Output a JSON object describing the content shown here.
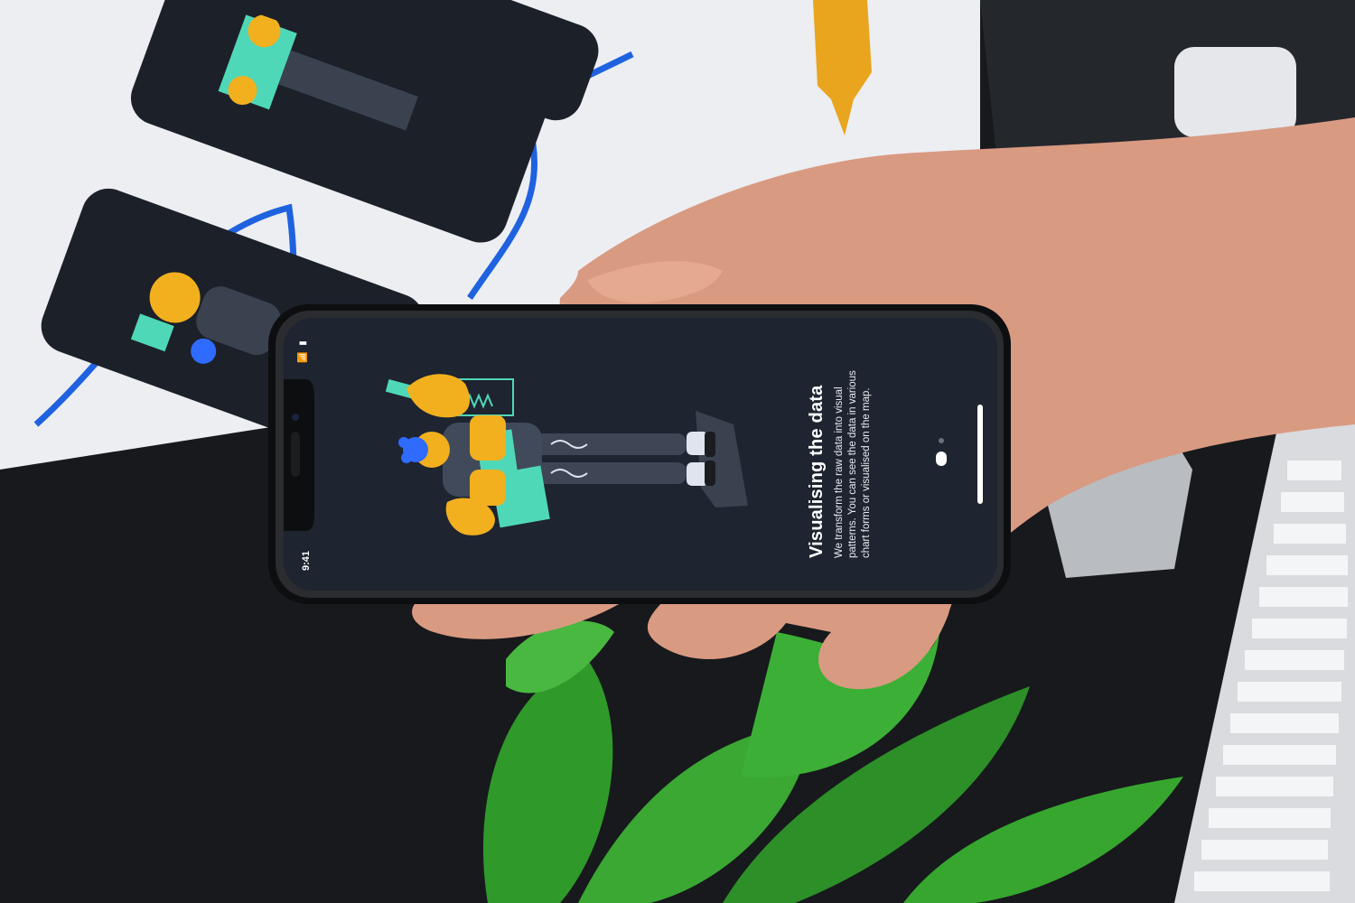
{
  "phone": {
    "status_time": "9:41",
    "status_icons": "📶 ▮",
    "onboarding": {
      "title": "Visualising the data",
      "body": "We transform the raw data into visual patterns. You can see the data in various chart forms or visualised on the map.",
      "page_indicator": {
        "pages": 2,
        "active_index": 1
      }
    }
  },
  "colors": {
    "screen_bg": "#1e2430",
    "accent_yellow": "#f2b01e",
    "accent_teal": "#4fd8b8",
    "accent_blue": "#2f6bff",
    "cable_blue": "#1f62e0",
    "leaf_green": "#2f9a2a"
  }
}
